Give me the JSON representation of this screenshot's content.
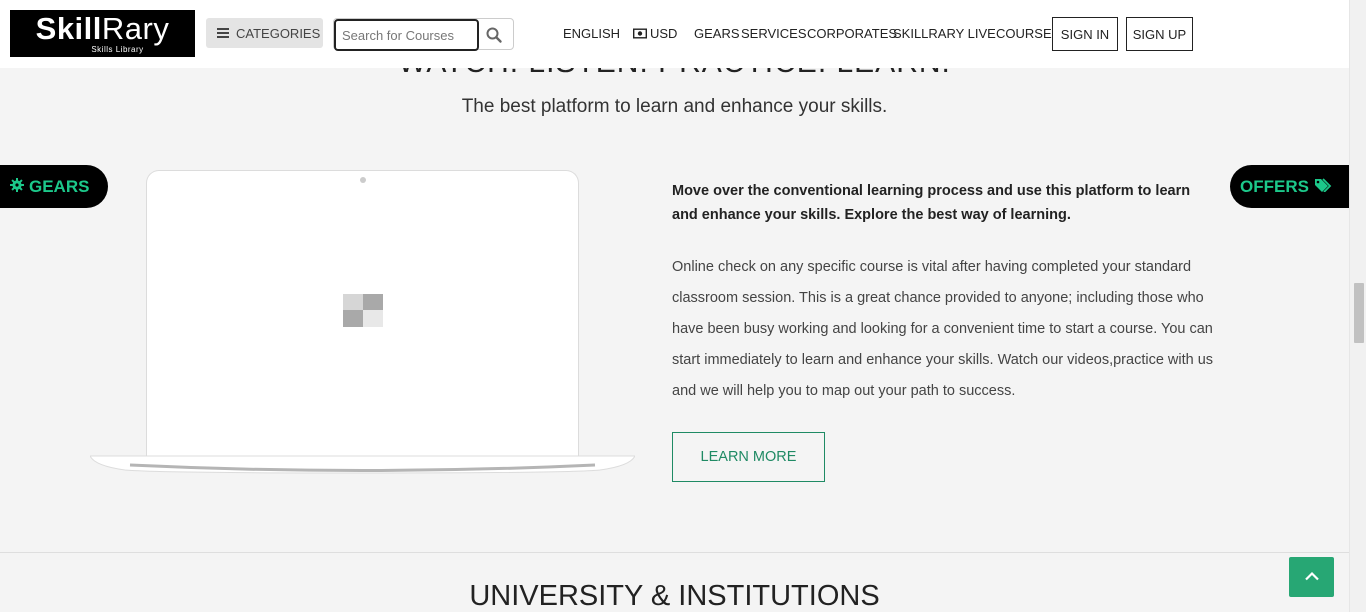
{
  "header": {
    "logo": {
      "name_bold": "Skill",
      "name_light": "Rary",
      "tagline": "Skills Library"
    },
    "categories_label": "CATEGORIES",
    "search": {
      "placeholder": "Search for Courses"
    },
    "language": "ENGLISH",
    "currency": "USD",
    "nav": [
      {
        "label": "GEARS"
      },
      {
        "label": "SERVICES"
      },
      {
        "label": "CORPORATES"
      },
      {
        "label": "SKILLRARY LIVE"
      },
      {
        "label": "COURSE"
      }
    ],
    "sign_in": "SIGN IN",
    "sign_up": "SIGN UP"
  },
  "section": {
    "title": "WATCH. LISTEN. PRACTICE. LEARN.",
    "subtitle": "The best platform to learn and enhance your skills.",
    "lead": "Move over the conventional learning process and use this platform to learn and enhance your skills. Explore the best way of learning.",
    "body": "Online check on any specific course is vital after having completed your standard classroom session. This is a great chance provided to anyone; including those who have been busy working and looking for a convenient time to start a course. You can start immediately to learn and enhance your skills. Watch our videos,practice with us and we will help you to map out your path to success.",
    "cta": "LEARN MORE"
  },
  "side_tabs": {
    "gears": "GEARS",
    "offers": "OFFERS"
  },
  "next_section_title": "UNIVERSITY & INSTITUTIONS",
  "colors": {
    "accent": "#1cc88a",
    "button_green": "#27a774",
    "outline_green": "#1f8a64"
  },
  "icons": {
    "categories": "hamburger-icon",
    "search": "search-icon",
    "currency": "money-bill-icon",
    "gears": "gear-icon",
    "offers": "tags-icon",
    "scroll_top": "chevron-up-icon"
  }
}
